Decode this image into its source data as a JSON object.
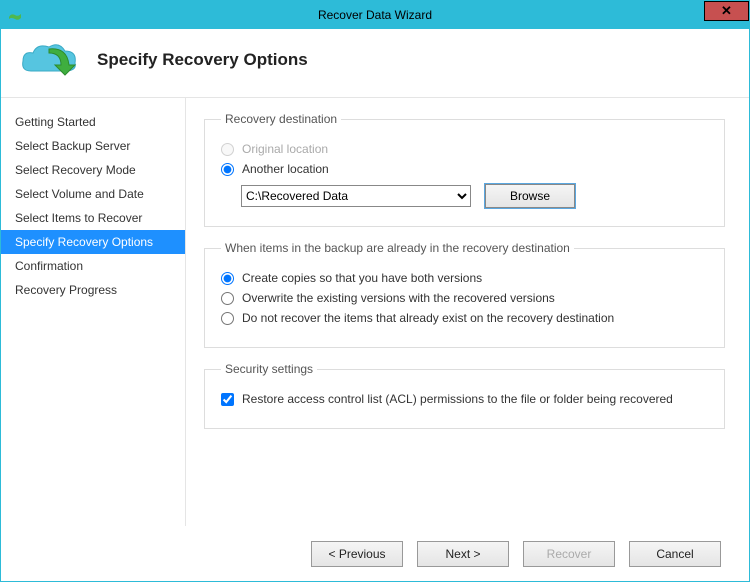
{
  "window": {
    "title": "Recover Data Wizard"
  },
  "header": {
    "title": "Specify Recovery Options"
  },
  "sidebar": {
    "items": [
      {
        "label": "Getting Started"
      },
      {
        "label": "Select Backup Server"
      },
      {
        "label": "Select Recovery Mode"
      },
      {
        "label": "Select Volume and Date"
      },
      {
        "label": "Select Items to Recover"
      },
      {
        "label": "Specify Recovery Options"
      },
      {
        "label": "Confirmation"
      },
      {
        "label": "Recovery Progress"
      }
    ],
    "active_index": 5
  },
  "destination": {
    "legend": "Recovery destination",
    "original_label": "Original location",
    "another_label": "Another location",
    "selected": "another",
    "path": "C:\\Recovered Data",
    "browse_label": "Browse"
  },
  "conflicts": {
    "legend": "When items in the backup are already in the recovery destination",
    "copies_label": "Create copies so that you have both versions",
    "overwrite_label": "Overwrite the existing versions with the recovered versions",
    "skip_label": "Do not recover the items that already exist on the recovery destination",
    "selected": "copies"
  },
  "security": {
    "legend": "Security settings",
    "acl_label": "Restore access control list (ACL) permissions to the file or folder being recovered",
    "acl_checked": true
  },
  "footer": {
    "previous": "< Previous",
    "next": "Next >",
    "recover": "Recover",
    "cancel": "Cancel"
  }
}
